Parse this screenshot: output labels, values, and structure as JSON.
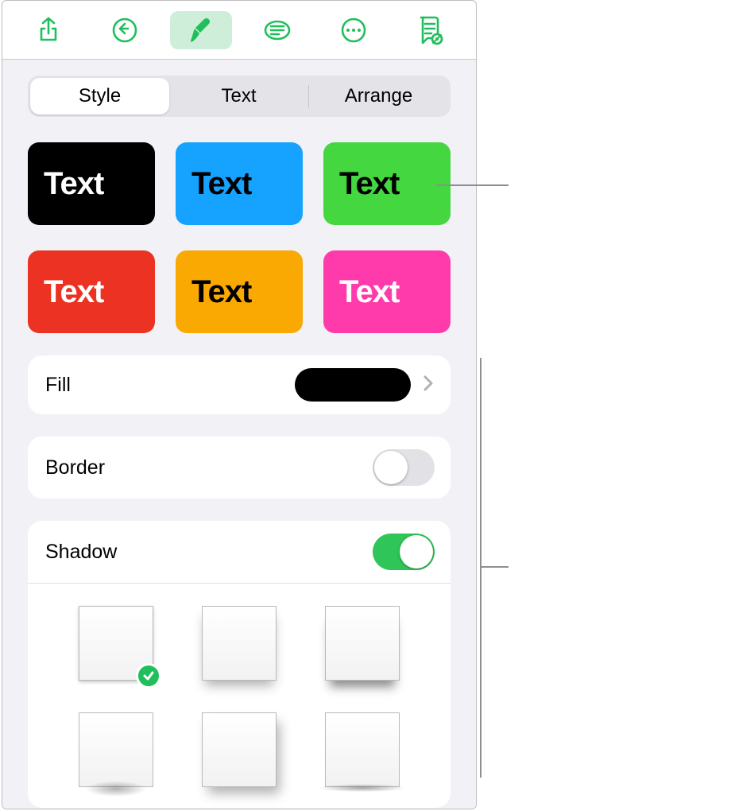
{
  "toolbar": {
    "icons": [
      "share-icon",
      "undo-icon",
      "format-brush-icon",
      "text-format-icon",
      "more-icon",
      "presenter-notes-icon"
    ],
    "active_index": 2
  },
  "tabs": {
    "items": [
      "Style",
      "Text",
      "Arrange"
    ],
    "selected": 0
  },
  "presets": [
    {
      "label": "Text",
      "bg": "#000000",
      "fg": "#ffffff"
    },
    {
      "label": "Text",
      "bg": "#15a3ff",
      "fg": "#000000"
    },
    {
      "label": "Text",
      "bg": "#44d740",
      "fg": "#000000"
    },
    {
      "label": "Text",
      "bg": "#eb3223",
      "fg": "#ffffff"
    },
    {
      "label": "Text",
      "bg": "#f9a901",
      "fg": "#000000"
    },
    {
      "label": "Text",
      "bg": "#ff3bac",
      "fg": "#ffffff"
    }
  ],
  "fill": {
    "label": "Fill",
    "swatch": "#000000"
  },
  "border": {
    "label": "Border",
    "on": false
  },
  "shadow": {
    "label": "Shadow",
    "on": true,
    "selected": 0
  },
  "colors": {
    "accent": "#1fbf5b"
  }
}
